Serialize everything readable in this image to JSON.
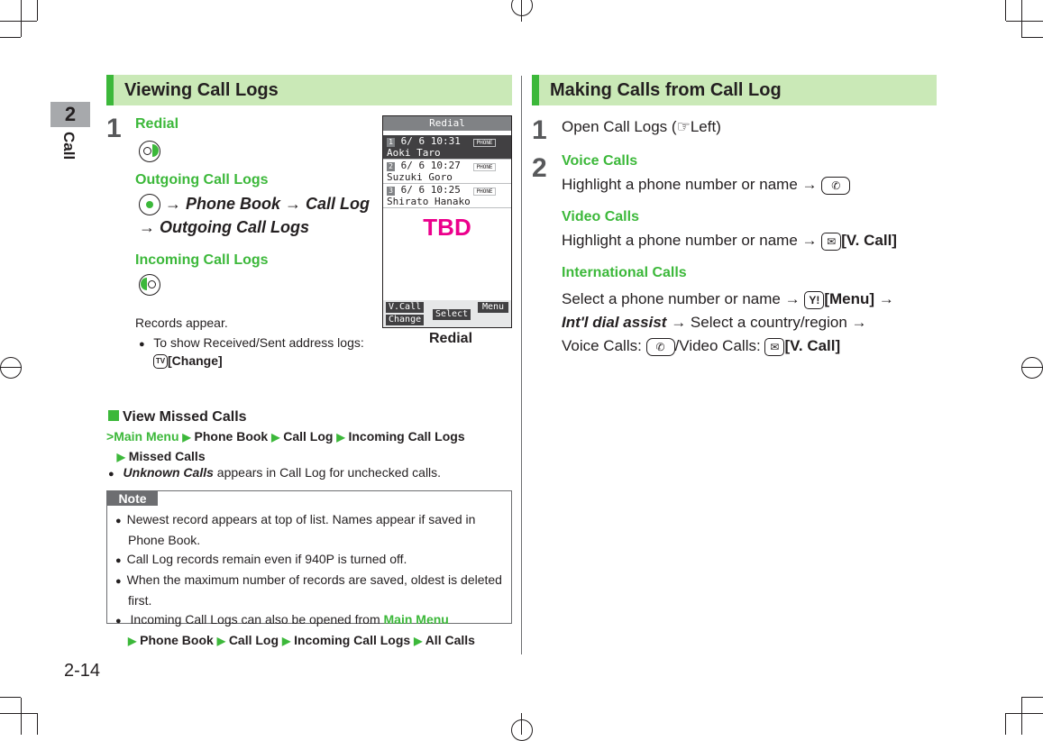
{
  "side_tab": {
    "chapter_number": "2",
    "chapter_label": "Call"
  },
  "page_number": "2-14",
  "left_section": {
    "title": "Viewing Call Logs",
    "step1": {
      "number": "1",
      "redial": {
        "label": "Redial",
        "key_icon": "nav-key-right-icon"
      },
      "outgoing": {
        "label": "Outgoing Call Logs",
        "key_icon": "nav-key-center-icon",
        "path": [
          "Phone Book",
          "Call Log",
          "Outgoing Call Logs"
        ]
      },
      "incoming": {
        "label": "Incoming Call Logs",
        "key_icon": "nav-key-left-icon"
      },
      "result": "Records appear.",
      "bullet": "To show Received/Sent address logs:",
      "bullet_key": "[Change]"
    },
    "phone_screen": {
      "title": "Redial",
      "records": [
        {
          "index": "1",
          "datetime": "6/ 6 10:31",
          "name": "Aoki Taro",
          "tag": "PHONE",
          "selected": true
        },
        {
          "index": "2",
          "datetime": "6/ 6 10:27",
          "name": "Suzuki Goro",
          "tag": "PHONE",
          "selected": false
        },
        {
          "index": "3",
          "datetime": "6/ 6 10:25",
          "name": "Shirato Hanako",
          "tag": "PHONE",
          "selected": false
        }
      ],
      "placeholder": "TBD",
      "softkeys": {
        "left_top": "V.Call",
        "left_bottom": "Change",
        "center": "Select",
        "right": "Menu"
      },
      "caption": "Redial"
    },
    "missed": {
      "title": "View Missed Calls",
      "path_start": "Main Menu",
      "path": [
        "Phone Book",
        "Call Log",
        "Incoming Call Logs",
        "Missed Calls"
      ],
      "bullet_em": "Unknown Calls",
      "bullet_rest": " appears in Call Log for unchecked calls."
    },
    "note": {
      "tag": "Note",
      "items": [
        "Newest record appears at top of list. Names appear if saved in Phone Book.",
        "Call Log records remain even if 940P is turned off.",
        "When the maximum number of records are saved, oldest is deleted first."
      ],
      "last_item_text": "Incoming Call Logs can also be opened from ",
      "last_item_path_start": "Main Menu",
      "last_item_path": [
        "Phone Book",
        "Call Log",
        "Incoming Call Logs",
        "All Calls"
      ]
    }
  },
  "right_section": {
    "title": "Making Calls from Call Log",
    "step1": {
      "number": "1",
      "text_before": "Open Call Logs (",
      "ref": "Left",
      "text_after": ")"
    },
    "step2": {
      "number": "2",
      "voice": {
        "label": "Voice Calls",
        "text": "Highlight a phone number or name →"
      },
      "video": {
        "label": "Video Calls",
        "text": "Highlight a phone number or name →",
        "key": "[V. Call]"
      },
      "intl": {
        "label": "International Calls",
        "line1": "Select a phone number or name →",
        "line1_key": "[Menu]",
        "line2_em": "Int'l dial assist",
        "line2_rest": "→ Select a country/region →",
        "line3_voice": "Voice Calls:",
        "line3_video": "/Video Calls:",
        "line3_key": "[V. Call]"
      }
    }
  }
}
